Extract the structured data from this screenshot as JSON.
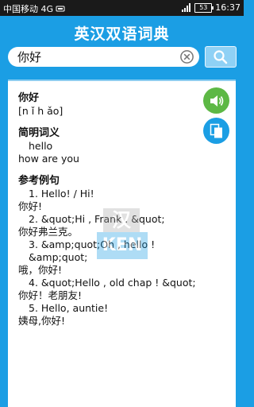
{
  "status_bar": {
    "carrier": "中国移动 4G",
    "network": "4G",
    "battery": "53",
    "time": "16:37"
  },
  "header": {
    "title": "英汉双语词典"
  },
  "search": {
    "value": "你好",
    "clear_icon": "clear-circle-x-icon",
    "button_icon": "search-icon"
  },
  "entry": {
    "word": "你好",
    "pinyin": "[n ǐ  h ǎo]",
    "brief_title": "简明词义",
    "brief_meanings": [
      "hello",
      "how are you"
    ],
    "examples_title": "参考例句",
    "examples": [
      {
        "en": "1. Hello! / Hi!",
        "zh": "你好!"
      },
      {
        "en": "2. &quot;Hi , Frank . &quot;",
        "zh": "你好弗兰克。"
      },
      {
        "en": "3. &amp;quot;Oh , hello ! &amp;quot;",
        "zh": "哦，你好!"
      },
      {
        "en": "4. &quot;Hello , old chap ! &quot;",
        "zh": "你好！老朋友!"
      },
      {
        "en": "5. Hello, auntie!",
        "zh": "姨母,你好!"
      }
    ]
  },
  "actions": {
    "speak_icon": "speaker-icon",
    "copy_icon": "copy-icon"
  },
  "colors": {
    "primary": "#1b9ee4",
    "speaker": "#5db845"
  },
  "watermark": {
    "top": "汉",
    "bottom": "KEN"
  }
}
